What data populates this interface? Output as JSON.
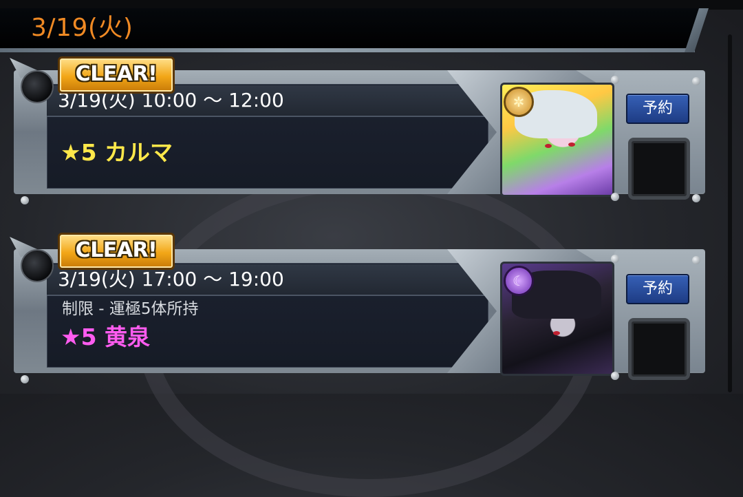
{
  "header": {
    "date": "3/19(火)"
  },
  "events": [
    {
      "badge": "CLEAR!",
      "time": "3/19(火) 10:00 〜 12:00",
      "restriction": "",
      "quest": "★5 カルマ",
      "quest_color": "#ffe84a",
      "portrait_icon": "karma-portrait",
      "element_icon": "light-element-icon",
      "reserve_label": "予約"
    },
    {
      "badge": "CLEAR!",
      "time": "3/19(火) 17:00 〜 19:00",
      "restriction": "制限 - 運極5体所持",
      "quest": "★5 黄泉",
      "quest_color": "#ff5cf0",
      "portrait_icon": "yomi-portrait",
      "element_icon": "dark-element-icon",
      "reserve_label": "予約"
    }
  ]
}
